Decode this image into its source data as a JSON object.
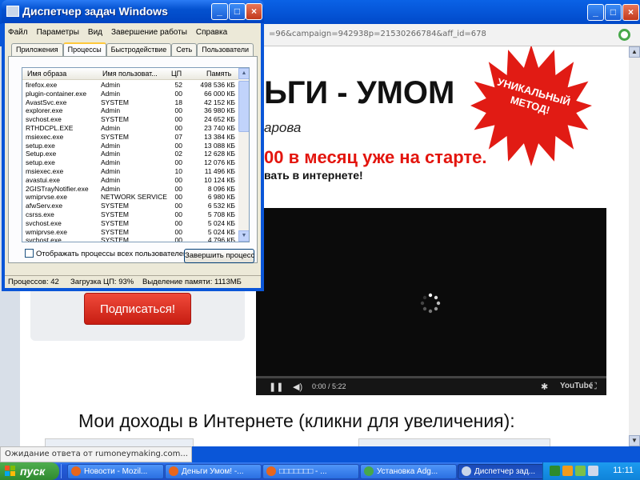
{
  "browser": {
    "url": "=96&campaign=942938p=21530266784&aff_id=678",
    "controls": {
      "minimize": "_",
      "maximize": "□",
      "close": "×"
    },
    "status_text": "Ожидание ответа от rumoneymaking.com..."
  },
  "page": {
    "headline": "ЬГИ - УМОМ",
    "author": "арова",
    "red_line": "00 в месяц уже на старте.",
    "sub_line": "вать в интернете!",
    "starburst": "УНИКАЛЬНЫЙ МЕТОД!",
    "subscribe_button": "Подписаться!",
    "income_title": "Мои доходы в Интернете (кликни для увеличения):",
    "video": {
      "time": "0:00 / 5:22",
      "brand": "YouTube",
      "progress": 0
    }
  },
  "task_manager": {
    "title": "Диспетчер задач Windows",
    "controls": {
      "minimize": "_",
      "maximize": "□",
      "close": "×"
    },
    "menu": [
      "Файл",
      "Параметры",
      "Вид",
      "Завершение работы",
      "Справка"
    ],
    "tabs": [
      "Приложения",
      "Процессы",
      "Быстродействие",
      "Сеть",
      "Пользователи"
    ],
    "active_tab": 1,
    "columns": {
      "name": "Имя образа",
      "user": "Имя пользоват...",
      "cpu": "ЦП",
      "mem": "Память"
    },
    "processes": [
      {
        "name": "firefox.exe",
        "user": "Admin",
        "cpu": "52",
        "mem": "498 536 КБ"
      },
      {
        "name": "plugin-container.exe",
        "user": "Admin",
        "cpu": "00",
        "mem": "66 000 КБ"
      },
      {
        "name": "AvastSvc.exe",
        "user": "SYSTEM",
        "cpu": "18",
        "mem": "42 152 КБ"
      },
      {
        "name": "explorer.exe",
        "user": "Admin",
        "cpu": "00",
        "mem": "36 980 КБ"
      },
      {
        "name": "svchost.exe",
        "user": "SYSTEM",
        "cpu": "00",
        "mem": "24 652 КБ"
      },
      {
        "name": "RTHDCPL.EXE",
        "user": "Admin",
        "cpu": "00",
        "mem": "23 740 КБ"
      },
      {
        "name": "msiexec.exe",
        "user": "SYSTEM",
        "cpu": "07",
        "mem": "13 384 КБ"
      },
      {
        "name": "setup.exe",
        "user": "Admin",
        "cpu": "00",
        "mem": "13 088 КБ"
      },
      {
        "name": "Setup.exe",
        "user": "Admin",
        "cpu": "02",
        "mem": "12 628 КБ"
      },
      {
        "name": "setup.exe",
        "user": "Admin",
        "cpu": "00",
        "mem": "12 076 КБ"
      },
      {
        "name": "msiexec.exe",
        "user": "Admin",
        "cpu": "10",
        "mem": "11 496 КБ"
      },
      {
        "name": "avastui.exe",
        "user": "Admin",
        "cpu": "00",
        "mem": "10 124 КБ"
      },
      {
        "name": "2GISTrayNotifier.exe",
        "user": "Admin",
        "cpu": "00",
        "mem": "8 096 КБ"
      },
      {
        "name": "wmiprvse.exe",
        "user": "NETWORK SERVICE",
        "cpu": "00",
        "mem": "6 980 КБ"
      },
      {
        "name": "afwServ.exe",
        "user": "SYSTEM",
        "cpu": "00",
        "mem": "6 532 КБ"
      },
      {
        "name": "csrss.exe",
        "user": "SYSTEM",
        "cpu": "00",
        "mem": "5 708 КБ"
      },
      {
        "name": "svchost.exe",
        "user": "SYSTEM",
        "cpu": "00",
        "mem": "5 024 КБ"
      },
      {
        "name": "wmiprvse.exe",
        "user": "SYSTEM",
        "cpu": "00",
        "mem": "5 024 КБ"
      },
      {
        "name": "svchost.exe",
        "user": "SYSTEM",
        "cpu": "00",
        "mem": "4 796 КБ"
      }
    ],
    "show_all_label": "Отображать процессы всех пользователей",
    "end_process_button": "Завершить процесс",
    "status": {
      "processes": "Процессов: 42",
      "cpu": "Загрузка ЦП: 93%",
      "memory": "Выделение памяти: 1113МБ"
    }
  },
  "taskbar": {
    "start_label": "пуск",
    "tasks": [
      {
        "label": "Новости - Mozil...",
        "icon": "firefox-icon",
        "active": false
      },
      {
        "label": "Деньги Умом! -...",
        "icon": "firefox-icon",
        "active": false
      },
      {
        "label": "□□□□□□□ - ...",
        "icon": "firefox-icon",
        "active": false
      },
      {
        "label": "Установка Adg...",
        "icon": "installer-icon",
        "active": false
      },
      {
        "label": "Диспетчер зад...",
        "icon": "task-manager-icon",
        "active": true
      }
    ],
    "clock": "11:11"
  },
  "colors": {
    "xp_blue": "#0a56d8",
    "start_green": "#3c9a3c",
    "headline_red": "#e3150e",
    "button_red": "#d9261a",
    "starburst_red": "#e11b14"
  }
}
